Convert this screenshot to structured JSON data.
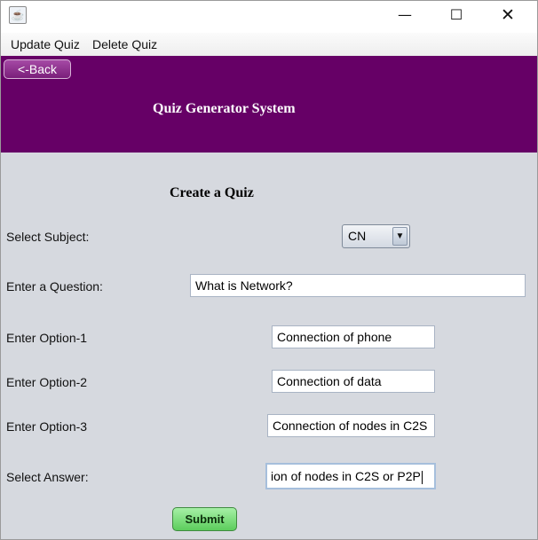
{
  "window": {
    "icon": "java-cup-icon",
    "controls": {
      "minimize": "—",
      "maximize": "☐",
      "close": "✕"
    }
  },
  "menu": {
    "items": [
      "Update Quiz",
      "Delete Quiz"
    ]
  },
  "header": {
    "back_label": "<-Back",
    "title": "Quiz Generator System",
    "color": "#660066"
  },
  "form": {
    "title": "Create a Quiz",
    "subject": {
      "label": "Select Subject:",
      "value": "CN"
    },
    "question": {
      "label": "Enter a Question:",
      "value": "What is Network?"
    },
    "option1": {
      "label": "Enter Option-1",
      "value": "Connection of phone"
    },
    "option2": {
      "label": "Enter Option-2",
      "value": "Connection of data"
    },
    "option3": {
      "label": "Enter Option-3",
      "value": "Connection of nodes in C2S"
    },
    "answer": {
      "label": "Select Answer:",
      "value": "ion of nodes in C2S or P2P"
    },
    "submit_label": "Submit"
  }
}
